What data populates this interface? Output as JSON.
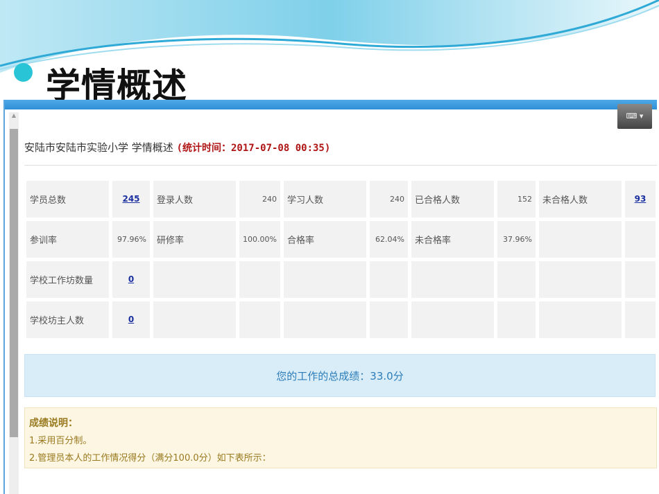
{
  "slide": {
    "title": "学情概述"
  },
  "page": {
    "school": "安陆市安陆市实验小学 学情概述",
    "stat_time": "(统计时间：2017-07-08 00:35)",
    "rows": [
      [
        {
          "label": "学员总数",
          "value": "245",
          "link": true
        },
        {
          "label": "登录人数",
          "value": "240"
        },
        {
          "label": "学习人数",
          "value": "240"
        },
        {
          "label": "已合格人数",
          "value": "152"
        },
        {
          "label": "未合格人数",
          "value": "93",
          "link": true
        }
      ],
      [
        {
          "label": "参训率",
          "value": "97.96%"
        },
        {
          "label": "研修率",
          "value": "100.00%"
        },
        {
          "label": "合格率",
          "value": "62.04%"
        },
        {
          "label": "未合格率",
          "value": "37.96%"
        },
        {
          "label": "",
          "value": ""
        }
      ],
      [
        {
          "label": "学校工作坊数量",
          "value": "0",
          "link": true
        },
        {
          "label": "",
          "value": ""
        },
        {
          "label": "",
          "value": ""
        },
        {
          "label": "",
          "value": ""
        },
        {
          "label": "",
          "value": ""
        }
      ],
      [
        {
          "label": "学校坊主人数",
          "value": "0",
          "link": true
        },
        {
          "label": "",
          "value": ""
        },
        {
          "label": "",
          "value": ""
        },
        {
          "label": "",
          "value": ""
        },
        {
          "label": "",
          "value": ""
        }
      ]
    ],
    "score": "您的工作的总成绩：33.0分",
    "note": {
      "title": "成绩说明：",
      "items": [
        "1.采用百分制。",
        "2.管理员本人的工作情况得分（满分100.0分）如下表所示："
      ]
    }
  }
}
